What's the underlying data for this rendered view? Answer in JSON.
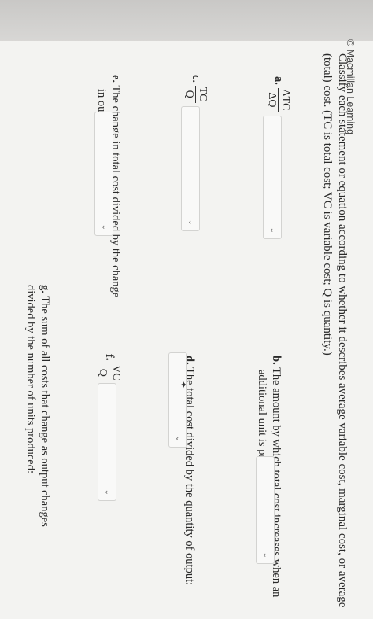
{
  "copyright": "© Macmillan Learning",
  "question": {
    "line1": "Classify each statement or equation according to whether it describes average variable cost, marginal cost, or average",
    "line2": "(total) cost. (TC is total cost; VC is variable cost; Q is quantity.)"
  },
  "items": {
    "a": {
      "letter": "a.",
      "numerator": "ΔTC",
      "denominator": "ΔQ",
      "colon": ":"
    },
    "b": {
      "letter": "b.",
      "line1": "The amount by which total cost increases when an",
      "line2": "additional unit is produced:"
    },
    "c": {
      "letter": "c.",
      "numerator": "TC",
      "denominator": "Q",
      "colon": ":"
    },
    "d": {
      "letter": "d.",
      "line1": "The total cost divided by the quantity of output:"
    },
    "e": {
      "letter": "e.",
      "line1": "The change in total cost divided by the change",
      "line2": "in output:"
    },
    "f": {
      "letter": "f.",
      "numerator": "VC",
      "denominator": "Q",
      "colon": ":"
    },
    "g": {
      "letter": "g.",
      "line1": "The sum of all costs that change as output changes",
      "line2": "divided by the number of units produced:"
    }
  },
  "dropdowns": {
    "chevron": "⌄",
    "selected": ""
  }
}
